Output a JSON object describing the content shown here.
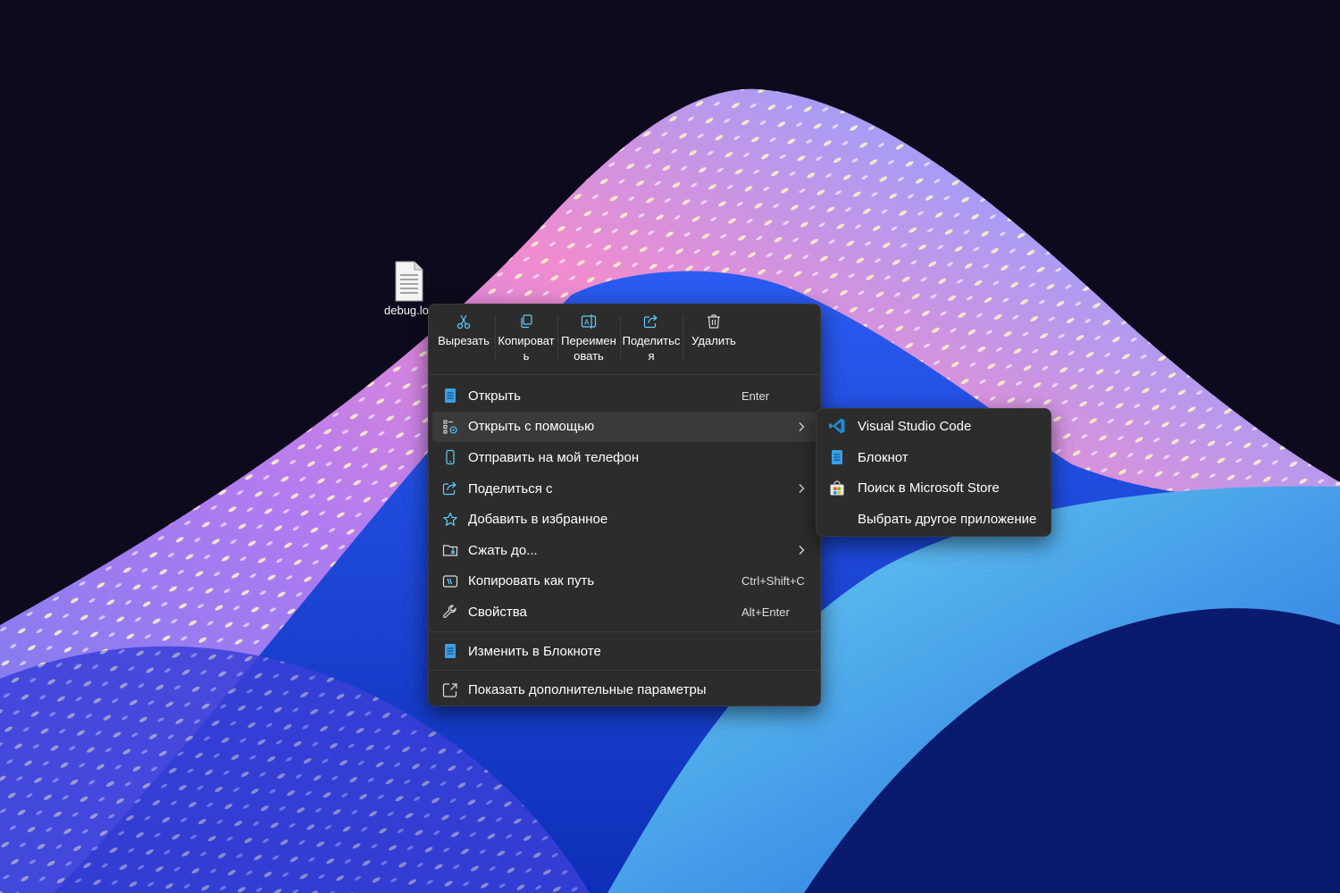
{
  "desktop": {
    "file_icon": "text-document-icon",
    "file_label": "debug.log"
  },
  "context_menu": {
    "toolbar": [
      {
        "name": "cut",
        "icon": "scissors-icon",
        "label": "Вырезать"
      },
      {
        "name": "copy",
        "icon": "copy-icon",
        "label": "Копировать"
      },
      {
        "name": "rename",
        "icon": "rename-icon",
        "label": "Переименовать"
      },
      {
        "name": "share",
        "icon": "share-icon",
        "label": "Поделиться"
      },
      {
        "name": "delete",
        "icon": "trash-icon",
        "label": "Удалить"
      }
    ],
    "items": [
      {
        "icon": "notepad-icon",
        "label": "Открыть",
        "shortcut": "Enter"
      },
      {
        "icon": "open-with-icon",
        "label": "Открыть с помощью",
        "has_submenu": true,
        "active": true
      },
      {
        "icon": "phone-icon",
        "label": "Отправить на мой телефон"
      },
      {
        "icon": "share-icon",
        "label": "Поделиться с",
        "has_submenu": true
      },
      {
        "icon": "star-icon",
        "label": "Добавить в избранное"
      },
      {
        "icon": "zip-folder-icon",
        "label": "Сжать до...",
        "has_submenu": true
      },
      {
        "icon": "copy-path-icon",
        "label": "Копировать как путь",
        "shortcut": "Ctrl+Shift+C"
      },
      {
        "icon": "wrench-icon",
        "label": "Свойства",
        "shortcut": "Alt+Enter"
      },
      {
        "icon": "notepad-icon",
        "label": "Изменить в Блокноте"
      },
      {
        "icon": "more-options-icon",
        "label": "Показать дополнительные параметры"
      }
    ]
  },
  "submenu": {
    "items": [
      {
        "icon": "vscode-icon",
        "label": "Visual Studio Code"
      },
      {
        "icon": "notepad-icon",
        "label": "Блокнот"
      },
      {
        "icon": "store-icon",
        "label": "Поиск в Microsoft Store"
      },
      {
        "icon": "",
        "label": "Выбрать другое приложение"
      }
    ]
  },
  "colors": {
    "menu_bg": "#2c2c2c",
    "accent": "#60cdff",
    "notepad_blue": "#3aa0e8"
  }
}
